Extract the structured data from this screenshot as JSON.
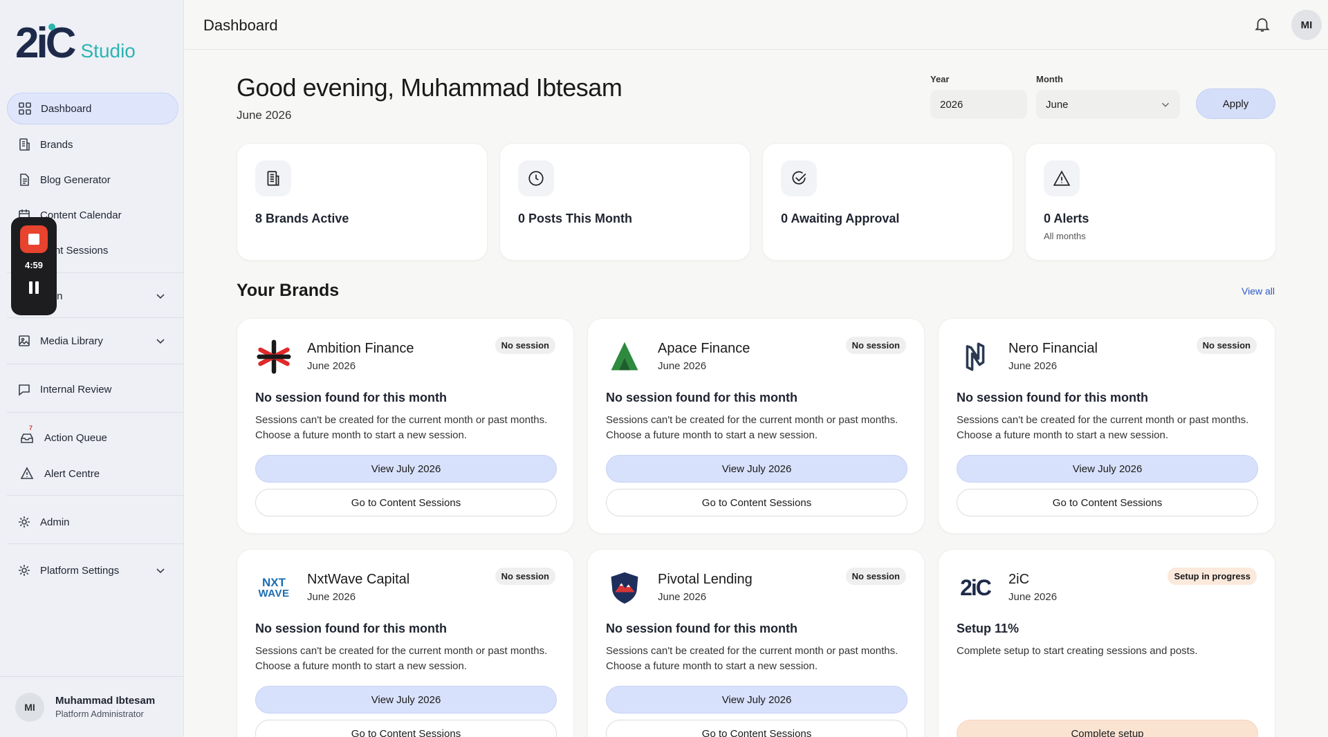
{
  "app": {
    "logo_text": "2iC",
    "logo_sub": "Studio",
    "page_title": "Dashboard"
  },
  "sidebar": {
    "items": [
      {
        "label": "Dashboard",
        "icon": "grid-icon",
        "active": true
      },
      {
        "label": "Brands",
        "icon": "building-icon"
      },
      {
        "label": "Blog Generator",
        "icon": "document-icon"
      },
      {
        "label": "Content Calendar",
        "icon": "calendar-icon"
      },
      {
        "label": "ntent Sessions",
        "icon": "sessions-icon"
      },
      {
        "label": "ation",
        "icon": "automation-icon",
        "expandable": true
      },
      {
        "label": "Media Library",
        "icon": "image-icon",
        "expandable": true
      },
      {
        "label": "Internal Review",
        "icon": "chat-icon"
      },
      {
        "label": "Action Queue",
        "icon": "inbox-icon",
        "badge": "7"
      },
      {
        "label": "Alert Centre",
        "icon": "warning-icon"
      },
      {
        "label": "Admin",
        "icon": "gear-icon"
      },
      {
        "label": "Platform Settings",
        "icon": "gear-icon",
        "expandable": true
      }
    ]
  },
  "user": {
    "initials": "MI",
    "name": "Muhammad Ibtesam",
    "role": "Platform Administrator"
  },
  "recorder": {
    "time": "4:59"
  },
  "header": {
    "greeting": "Good evening, Muhammad Ibtesam",
    "period": "June 2026",
    "year_label": "Year",
    "year_value": "2026",
    "month_label": "Month",
    "month_value": "June",
    "apply_label": "Apply"
  },
  "stats": [
    {
      "label": "8 Brands Active",
      "icon": "building-icon"
    },
    {
      "label": "0 Posts This Month",
      "icon": "clock-icon"
    },
    {
      "label": "0 Awaiting Approval",
      "icon": "check-circle-icon"
    },
    {
      "label": "0 Alerts",
      "sub": "All months",
      "icon": "warning-icon"
    }
  ],
  "brands_section": {
    "title": "Your Brands",
    "view_all": "View all"
  },
  "brands": [
    {
      "name": "Ambition Finance",
      "date": "June 2026",
      "badge": "No session",
      "heading": "No session found for this month",
      "desc": "Sessions can't be created for the current month or past months. Choose a future month to start a new session.",
      "primary": "View July 2026",
      "secondary": "Go to Content Sessions"
    },
    {
      "name": "Apace Finance",
      "date": "June 2026",
      "badge": "No session",
      "heading": "No session found for this month",
      "desc": "Sessions can't be created for the current month or past months. Choose a future month to start a new session.",
      "primary": "View July 2026",
      "secondary": "Go to Content Sessions"
    },
    {
      "name": "Nero Financial",
      "date": "June 2026",
      "badge": "No session",
      "heading": "No session found for this month",
      "desc": "Sessions can't be created for the current month or past months. Choose a future month to start a new session.",
      "primary": "View July 2026",
      "secondary": "Go to Content Sessions"
    },
    {
      "name": "NxtWave Capital",
      "date": "June 2026",
      "badge": "No session",
      "heading": "No session found for this month",
      "desc": "Sessions can't be created for the current month or past months. Choose a future month to start a new session.",
      "primary": "View July 2026",
      "secondary": "Go to Content Sessions",
      "logo_text_1": "NXT",
      "logo_text_2": "WAVE"
    },
    {
      "name": "Pivotal Lending",
      "date": "June 2026",
      "badge": "No session",
      "heading": "No session found for this month",
      "desc": "Sessions can't be created for the current month or past months. Choose a future month to start a new session.",
      "primary": "View July 2026",
      "secondary": "Go to Content Sessions"
    },
    {
      "name": "2iC",
      "date": "June 2026",
      "badge": "Setup in progress",
      "heading": "Setup 11%",
      "desc": "Complete setup to start creating sessions and posts.",
      "setup": "Complete setup",
      "logo_text": "2iC"
    }
  ],
  "colors": {
    "accent": "#d8e1fb",
    "brand_teal": "#2bb5b0",
    "link": "#2956c8",
    "setup_bg": "#fbe3d2"
  }
}
